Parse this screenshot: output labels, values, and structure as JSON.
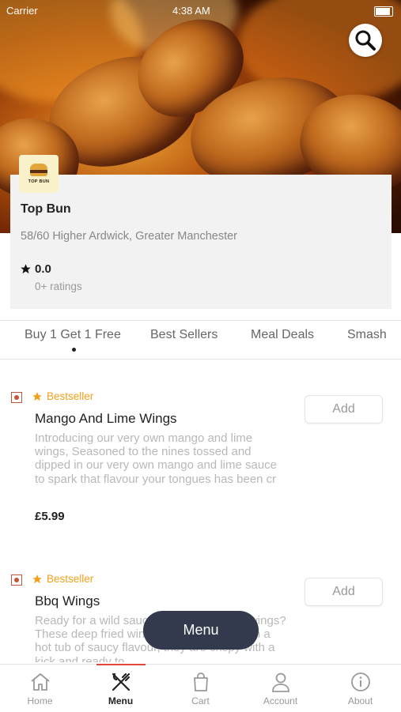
{
  "status_bar": {
    "carrier": "Carrier",
    "time": "4:38 AM"
  },
  "restaurant": {
    "logo_text": "TOP BUN",
    "name": "Top Bun",
    "address": "58/60 Higher Ardwick, Greater Manchester",
    "rating": "0.0",
    "ratings_count": "0+ ratings"
  },
  "category_tabs": [
    {
      "label": "Buy 1 Get 1 Free",
      "selected": true
    },
    {
      "label": "Best Sellers"
    },
    {
      "label": "Meal Deals"
    },
    {
      "label": "Smash"
    }
  ],
  "menu_items": [
    {
      "badge": "Bestseller",
      "name": "Mango And Lime Wings",
      "description": "Introducing our very own mango and lime wings, Seasoned to the nines tossed and dipped in our very own mango and lime sauce to spark that flavour your tongues has been cr",
      "price": "£5.99",
      "add_label": "Add"
    },
    {
      "badge": "Bestseller",
      "name": "Bbq Wings",
      "description": "Ready for a wild sauce taste of our BBQ wings? These deep fried wings have taken a dip in a hot tub of saucy flavour, they are crispy with a kick and ready to",
      "add_label": "Add"
    }
  ],
  "menu_button": "Menu",
  "bottom_nav": [
    {
      "label": "Home",
      "icon": "home-icon"
    },
    {
      "label": "Menu",
      "icon": "fork-knife-icon",
      "active": true
    },
    {
      "label": "Cart",
      "icon": "shopping-bag-icon"
    },
    {
      "label": "Account",
      "icon": "user-icon"
    },
    {
      "label": "About",
      "icon": "info-icon"
    }
  ],
  "colors": {
    "accent": "#e0453a",
    "bestseller": "#f2a01c",
    "fab": "#333a4d"
  }
}
